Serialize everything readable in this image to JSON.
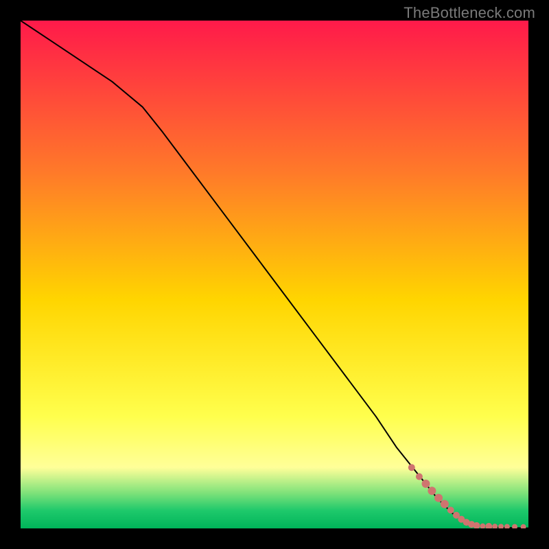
{
  "watermark": "TheBottleneck.com",
  "colors": {
    "line": "#000000",
    "point_fill": "#cf746f",
    "point_stroke": "#cf746f",
    "gradient_top": "#ff1a4a",
    "gradient_mid1": "#ff7a29",
    "gradient_mid2": "#ffd500",
    "gradient_mid3": "#ffff4d",
    "gradient_band": "#ffff99",
    "gradient_green1": "#7fe27a",
    "gradient_green2": "#1ec96b",
    "gradient_bottom": "#00b45a"
  },
  "chart_data": {
    "type": "line",
    "title": "",
    "xlabel": "",
    "ylabel": "",
    "xlim": [
      0,
      100
    ],
    "ylim": [
      0,
      100
    ],
    "series": [
      {
        "name": "curve",
        "kind": "line",
        "x": [
          0,
          6,
          12,
          18,
          24,
          28,
          34,
          40,
          46,
          52,
          58,
          64,
          70,
          74,
          78,
          82,
          85,
          88,
          91,
          94,
          97,
          100
        ],
        "y": [
          100,
          96,
          92,
          88,
          83,
          78,
          70,
          62,
          54,
          46,
          38,
          30,
          22,
          16,
          11,
          6,
          3,
          1,
          0.4,
          0.2,
          0.1,
          0.05
        ]
      },
      {
        "name": "points",
        "kind": "scatter",
        "points": [
          {
            "x": 77.0,
            "y": 12.0,
            "r": 5
          },
          {
            "x": 78.5,
            "y": 10.2,
            "r": 5
          },
          {
            "x": 79.8,
            "y": 8.8,
            "r": 6
          },
          {
            "x": 81.0,
            "y": 7.4,
            "r": 6
          },
          {
            "x": 82.3,
            "y": 6.0,
            "r": 6
          },
          {
            "x": 83.5,
            "y": 4.8,
            "r": 6
          },
          {
            "x": 84.7,
            "y": 3.6,
            "r": 5
          },
          {
            "x": 85.8,
            "y": 2.6,
            "r": 5
          },
          {
            "x": 86.8,
            "y": 1.8,
            "r": 5
          },
          {
            "x": 87.8,
            "y": 1.2,
            "r": 5
          },
          {
            "x": 88.8,
            "y": 0.8,
            "r": 5
          },
          {
            "x": 89.8,
            "y": 0.55,
            "r": 5
          },
          {
            "x": 91.0,
            "y": 0.45,
            "r": 4
          },
          {
            "x": 92.2,
            "y": 0.4,
            "r": 5
          },
          {
            "x": 93.4,
            "y": 0.38,
            "r": 4
          },
          {
            "x": 94.6,
            "y": 0.36,
            "r": 4
          },
          {
            "x": 95.8,
            "y": 0.34,
            "r": 4
          },
          {
            "x": 97.3,
            "y": 0.32,
            "r": 4
          },
          {
            "x": 99.0,
            "y": 0.3,
            "r": 4
          }
        ]
      }
    ]
  },
  "gradient_stops": [
    {
      "offset": 0,
      "key": "gradient_top"
    },
    {
      "offset": 0.3,
      "key": "gradient_mid1"
    },
    {
      "offset": 0.55,
      "key": "gradient_mid2"
    },
    {
      "offset": 0.78,
      "key": "gradient_mid3"
    },
    {
      "offset": 0.88,
      "key": "gradient_band"
    },
    {
      "offset": 0.93,
      "key": "gradient_green1"
    },
    {
      "offset": 0.965,
      "key": "gradient_green2"
    },
    {
      "offset": 1.0,
      "key": "gradient_bottom"
    }
  ]
}
